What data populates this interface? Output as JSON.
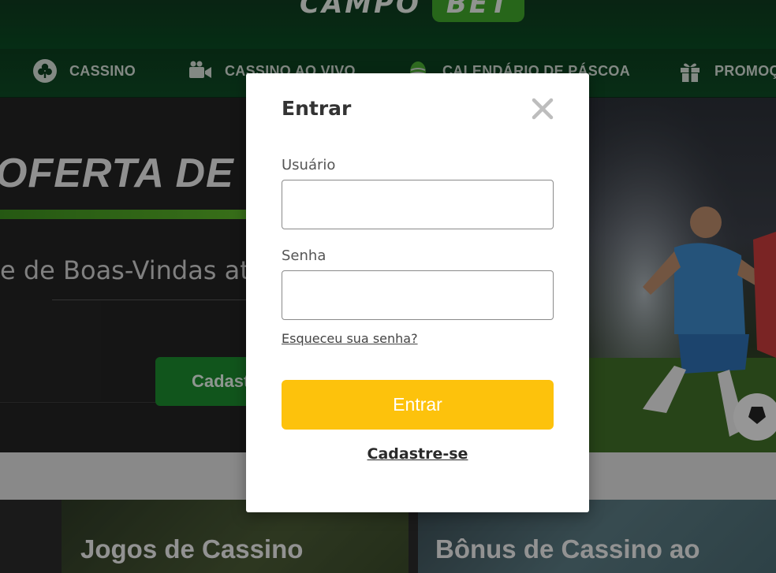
{
  "brand": {
    "logo_left": "CAMPO",
    "logo_right": "BET"
  },
  "nav": {
    "items": [
      {
        "label": "CASSINO",
        "icon": "club-icon"
      },
      {
        "label": "CASSINO AO VIVO",
        "icon": "video-camera-icon"
      },
      {
        "label": "CALENDÁRIO DE PÁSCOA",
        "icon": "easter-egg-icon"
      },
      {
        "label": "PROMOÇ",
        "icon": "gift-icon"
      }
    ]
  },
  "hero": {
    "title": "OFERTA DE E",
    "subtitle": "e de Boas-Vindas at",
    "cta_label": "Cadast"
  },
  "cards": [
    {
      "title": "Jogos de Cassino"
    },
    {
      "title": "Bônus de Cassino ao"
    }
  ],
  "login_modal": {
    "title": "Entrar",
    "username_label": "Usuário",
    "username_value": "",
    "password_label": "Senha",
    "password_value": "",
    "forgot_link": "Esqueceu sua senha?",
    "submit_label": "Entrar",
    "signup_link": "Cadastre-se"
  },
  "colors": {
    "accent_yellow": "#fdc20c",
    "brand_green": "#1c8a2e",
    "header_green": "#0c3d1e"
  }
}
